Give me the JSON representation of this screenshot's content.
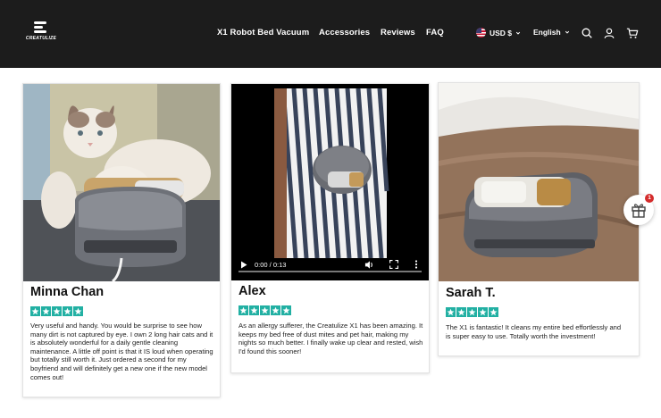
{
  "brand": {
    "logo_text": "CREATULIZE"
  },
  "nav": {
    "items": [
      "X1 Robot Bed Vacuum",
      "Accessories",
      "Reviews",
      "FAQ"
    ]
  },
  "locale": {
    "currency": "USD $",
    "language": "English"
  },
  "icons": [
    "search-icon",
    "account-icon",
    "cart-icon",
    "gift-icon"
  ],
  "colors": {
    "header_bg": "#1c1c1c",
    "star": "#22b0a3",
    "badge": "#d42b2b"
  },
  "reviews": [
    {
      "name": "Minna Chan",
      "rating": 5,
      "text": "Very useful and handy. You would be surprise to see how many dirt is not captured by eye. I own 2 long hair cats and it is absolutely wonderful for a daily gentle cleaning maintenance. A little off point is that it IS loud when operating but totally still worth it. Just ordered a second for my boyfriend and will definitely get a new one if the new model comes out!"
    },
    {
      "name": "Alex",
      "rating": 5,
      "text": "As an allergy sufferer, the Creatulize X1 has been amazing. It keeps my bed free of dust mites and pet hair, making my nights so much better. I finally wake up clear and rested, wish I'd found this sooner!"
    },
    {
      "name": "Sarah T.",
      "rating": 5,
      "text": "The X1 is fantastic! It cleans my entire bed effortlessly and is super easy to use. Totally worth the investment!"
    }
  ],
  "video": {
    "time": "0:00 / 0:13"
  },
  "gift": {
    "badge_count": "1"
  }
}
